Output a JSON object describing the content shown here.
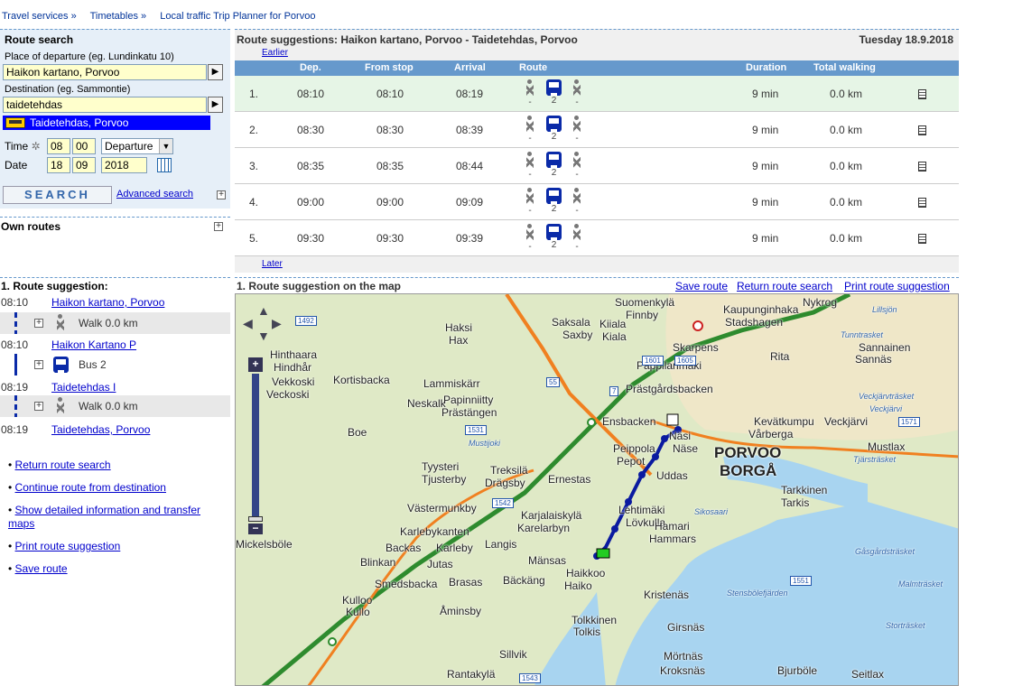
{
  "breadcrumb": [
    "Travel services »",
    "Timetables »",
    "Local traffic Trip Planner for Porvoo"
  ],
  "search": {
    "title": "Route search",
    "departure_label": "Place of departure   (eg. Lundinkatu 10)",
    "departure_value": "Haikon kartano, Porvoo",
    "destination_label": "Destination   (eg. Sammontie)",
    "destination_value": "taidetehdas",
    "suggestion": "Taidetehdas, Porvoo",
    "time_label": "Time",
    "hour": "08",
    "minute": "00",
    "time_mode": "Departure",
    "date_label": "Date",
    "day": "18",
    "month": "09",
    "year": "2018",
    "search_button": "SEARCH",
    "advanced": "Advanced search"
  },
  "own_routes": "Own routes",
  "results": {
    "title": "Route suggestions: Haikon kartano, Porvoo - Taidetehdas, Porvoo",
    "date": "Tuesday 18.9.2018",
    "earlier": "Earlier",
    "later": "Later",
    "headers": [
      "Dep.",
      "From stop",
      "Arrival",
      "Route",
      "Duration",
      "Total walking"
    ],
    "rows": [
      {
        "n": "1.",
        "dep": "08:10",
        "from": "08:10",
        "arr": "08:19",
        "walk1": "-",
        "line": "2",
        "walk2": "-",
        "dur": "9 min",
        "walk": "0.0 km"
      },
      {
        "n": "2.",
        "dep": "08:30",
        "from": "08:30",
        "arr": "08:39",
        "walk1": "-",
        "line": "2",
        "walk2": "-",
        "dur": "9 min",
        "walk": "0.0 km"
      },
      {
        "n": "3.",
        "dep": "08:35",
        "from": "08:35",
        "arr": "08:44",
        "walk1": "-",
        "line": "2",
        "walk2": "-",
        "dur": "9 min",
        "walk": "0.0 km"
      },
      {
        "n": "4.",
        "dep": "09:00",
        "from": "09:00",
        "arr": "09:09",
        "walk1": "-",
        "line": "2",
        "walk2": "-",
        "dur": "9 min",
        "walk": "0.0 km"
      },
      {
        "n": "5.",
        "dep": "09:30",
        "from": "09:30",
        "arr": "09:39",
        "walk1": "-",
        "line": "2",
        "walk2": "-",
        "dur": "9 min",
        "walk": "0.0 km"
      }
    ]
  },
  "detail": {
    "title": "1. Route suggestion:",
    "stops": [
      {
        "time": "08:10",
        "name": "Haikon kartano, Porvoo"
      },
      {
        "time": "08:10",
        "name": "Haikon Kartano P"
      },
      {
        "time": "08:19",
        "name": "Taidetehdas I"
      },
      {
        "time": "08:19",
        "name": "Taidetehdas, Porvoo"
      }
    ],
    "legs": [
      "Walk 0.0 km",
      "Bus 2",
      "Walk 0.0 km"
    ],
    "links": [
      "Return route search",
      "Continue route from destination",
      "Show detailed information and transfer maps",
      "Print route suggestion",
      "Save route"
    ]
  },
  "map": {
    "title": "1. Route suggestion on the map",
    "actions": [
      "Save route",
      "Return route search",
      "Print route suggestion"
    ],
    "places": [
      "Suomenkylä",
      "Finnby",
      "Nykrog",
      "Saksala",
      "Saxby",
      "Kaupunginhaka",
      "Stadshagen",
      "Haksi",
      "Hax",
      "Kiiala",
      "Kiala",
      "Skarpens",
      "Rita",
      "Sannainen",
      "Sannäs",
      "Hinthaara",
      "Hindhår",
      "Vekkoski",
      "Veckoski",
      "Kortisbacka",
      "Lammiskärr",
      "Pappilanmäki",
      "Prästgårdsbacken",
      "Neskalk",
      "Papinniitty",
      "Prästängen",
      "Ensbacken",
      "Kevätkumpu",
      "Vårberga",
      "Veckjärvi",
      "Näsi",
      "Näse",
      "Boe",
      "Peippola",
      "Pepot",
      "PORVOO",
      "BORGÅ",
      "Mustlax",
      "Tyysteri",
      "Tjusterby",
      "Treksilä",
      "Drägsby",
      "Ernestas",
      "Uddas",
      "Tarkkinen",
      "Tarkis",
      "Västermunkby",
      "Lehtimäki",
      "Lövkulla",
      "Karjalaiskylä",
      "Karelarbyn",
      "Hamari",
      "Hammars",
      "Karlebykanten",
      "Backas",
      "Karleby",
      "Langis",
      "Blinkan",
      "Jutas",
      "Mänsas",
      "Haikkoo",
      "Haiko",
      "Smedsbacka",
      "Bäckäng",
      "Brasas",
      "Kristenäs",
      "Kulloo",
      "Kullo",
      "Åminsby",
      "Tolkkinen",
      "Tolkis",
      "Girsnäs",
      "Sillvik",
      "Mörtnäs",
      "Rantakylä",
      "Kroksnäs",
      "Bjurböle",
      "Seitlax",
      "Mickelsböle"
    ],
    "water": [
      "Lillsjön",
      "Tunntrasket",
      "Veckjärvi",
      "Veckjärvträsket",
      "Tjärsträsket",
      "Sikosaari",
      "Gåsgårdsträsket",
      "Stensbölefjärden",
      "Malmträsket",
      "Storträsket",
      "Mustijoki"
    ],
    "roads": [
      "1492",
      "55",
      "1601",
      "1605",
      "7",
      "1531",
      "1542",
      "1543",
      "1551",
      "1571"
    ]
  }
}
